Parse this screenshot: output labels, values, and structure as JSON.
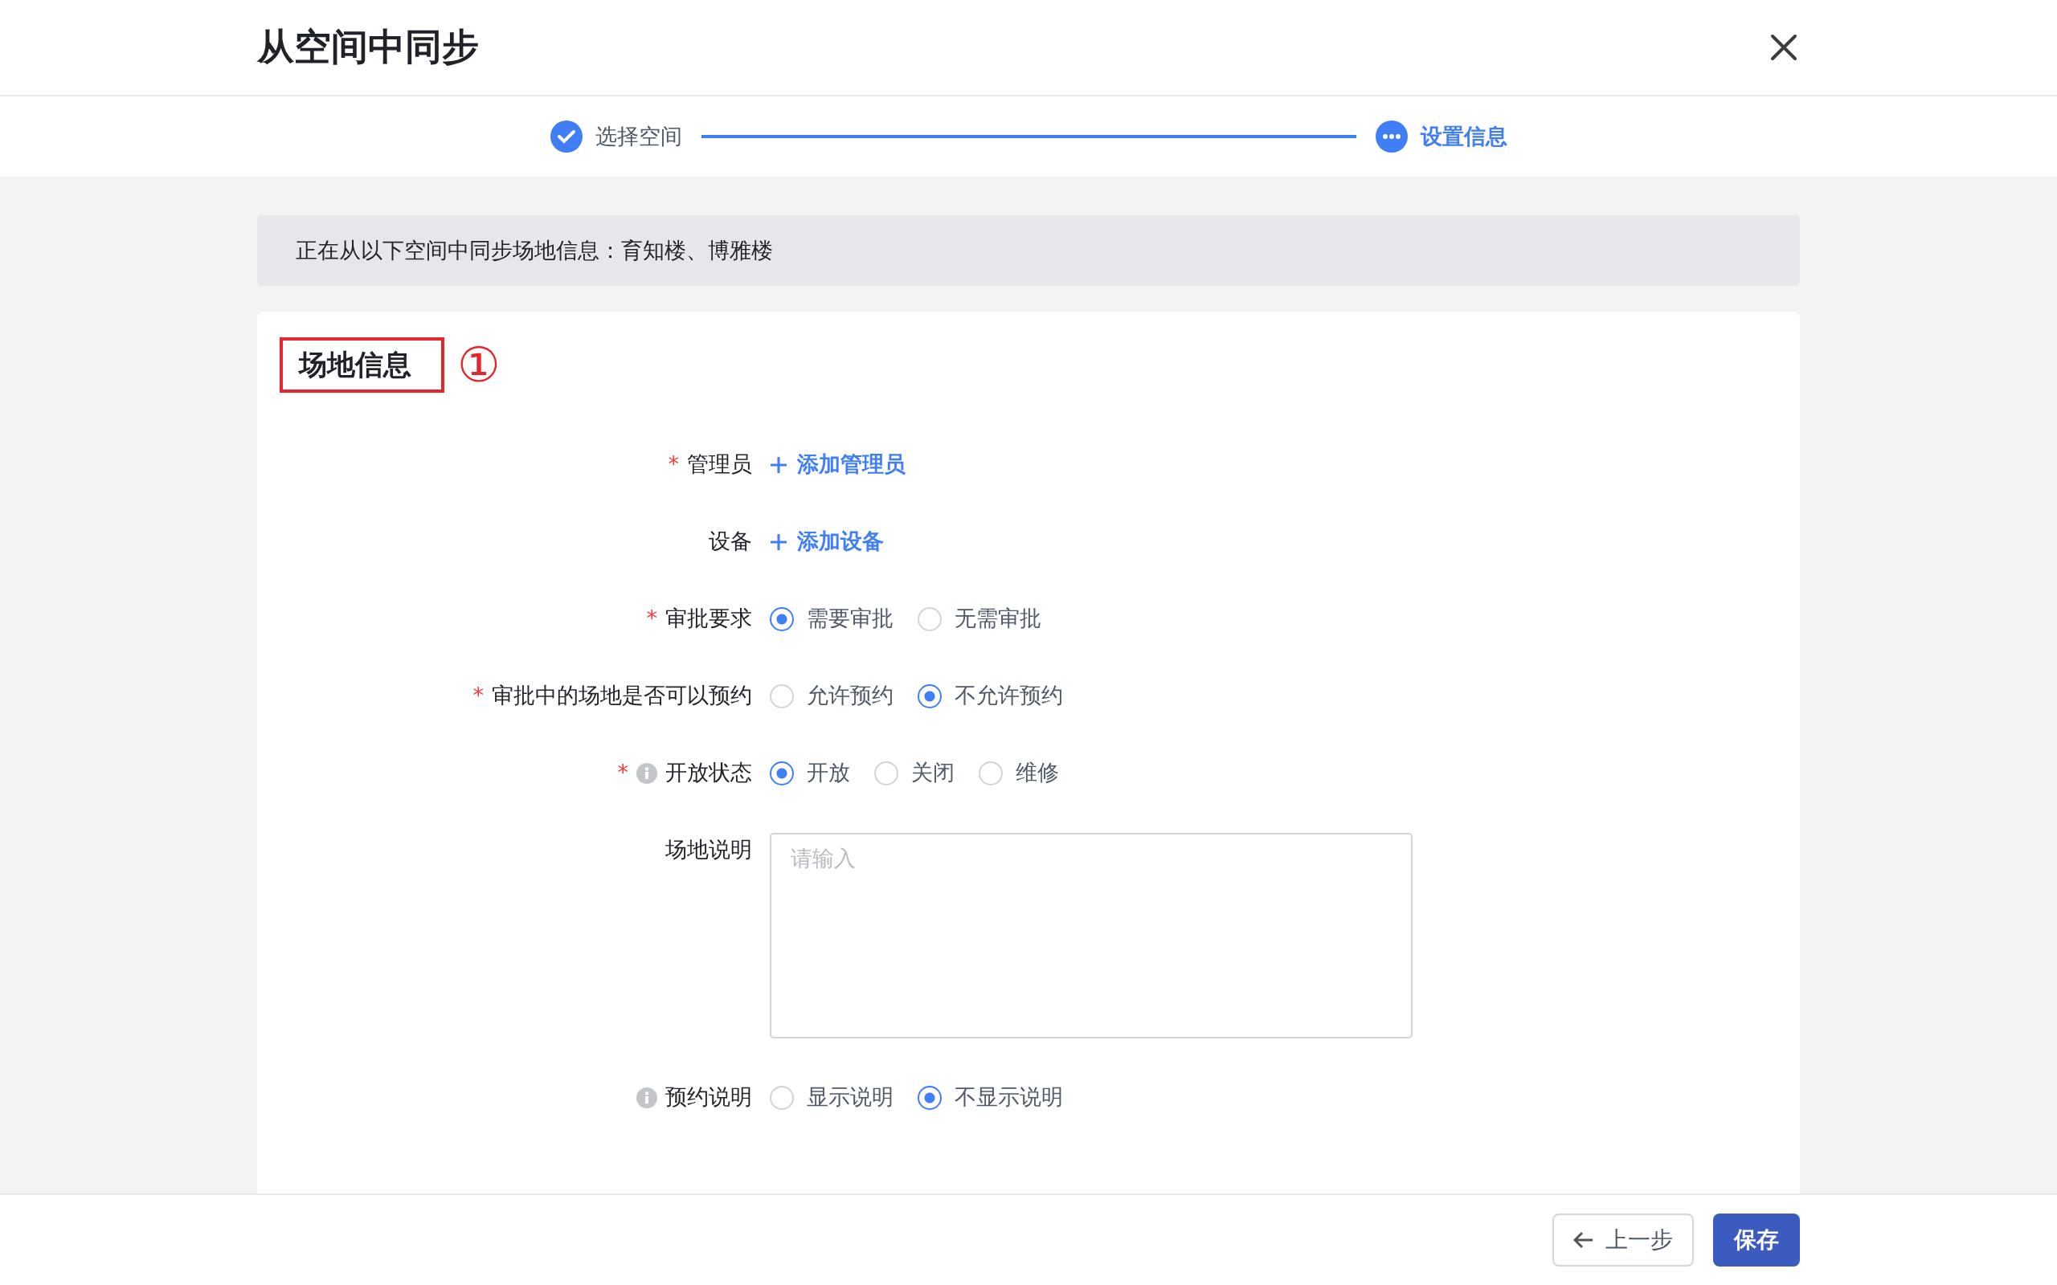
{
  "dialog": {
    "title": "从空间中同步"
  },
  "steps": [
    {
      "label": "选择空间",
      "completed": true,
      "selected": false
    },
    {
      "label": "设置信息",
      "completed": false,
      "selected": true
    }
  ],
  "notice": "正在从以下空间中同步场地信息：育知楼、博雅楼",
  "section": {
    "title": "场地信息",
    "annotation": "①"
  },
  "fields": [
    {
      "kind": "link",
      "required_mark": "*",
      "label": "管理员",
      "info": false,
      "action": "添加管理员"
    },
    {
      "kind": "link",
      "label": "设备",
      "info": false,
      "action": "添加设备"
    },
    {
      "kind": "radio",
      "required_mark": "*",
      "label": "审批要求",
      "info": false,
      "options": [
        {
          "label": "需要审批",
          "selected": true
        },
        {
          "label": "无需审批",
          "selected": false
        }
      ]
    },
    {
      "kind": "radio",
      "required_mark": "*",
      "label": "审批中的场地是否可以预约",
      "info": false,
      "options": [
        {
          "label": "允许预约",
          "selected": false
        },
        {
          "label": "不允许预约",
          "selected": true
        }
      ]
    },
    {
      "kind": "radio",
      "required_mark": "*",
      "label": "开放状态",
      "info": true,
      "options": [
        {
          "label": "开放",
          "selected": true
        },
        {
          "label": "关闭",
          "selected": false
        },
        {
          "label": "维修",
          "selected": false
        }
      ]
    },
    {
      "kind": "textarea",
      "label": "场地说明",
      "info": false,
      "placeholder": "请输入"
    },
    {
      "kind": "radio",
      "label": "预约说明",
      "info": true,
      "options": [
        {
          "label": "显示说明",
          "selected": false
        },
        {
          "label": "不显示说明",
          "selected": true
        }
      ]
    }
  ],
  "footer": {
    "buttons": [
      {
        "kind": "back",
        "label": "上一步"
      },
      {
        "kind": "primary",
        "label": "保存"
      }
    ]
  }
}
